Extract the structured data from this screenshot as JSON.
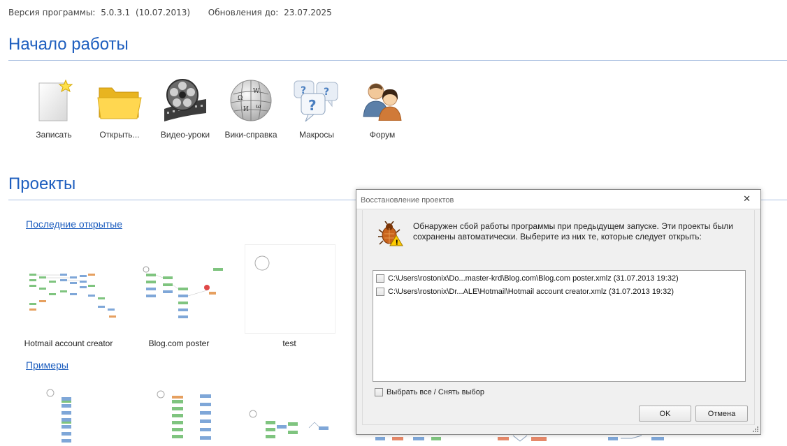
{
  "version_bar": {
    "version_label": "Версия программы:",
    "version_value": "5.0.3.1",
    "version_date": "(10.07.2013)",
    "updates_label": "Обновления до:",
    "updates_value": "23.07.2025"
  },
  "start": {
    "title": "Начало работы",
    "actions": [
      {
        "label": "Записать",
        "icon": "new-document-icon"
      },
      {
        "label": "Открыть...",
        "icon": "folder-icon"
      },
      {
        "label": "Видео-уроки",
        "icon": "film-reel-icon"
      },
      {
        "label": "Вики-справка",
        "icon": "wikipedia-globe-icon"
      },
      {
        "label": "Макросы",
        "icon": "question-bubbles-icon"
      },
      {
        "label": "Форум",
        "icon": "users-icon"
      }
    ]
  },
  "projects": {
    "title": "Проекты",
    "recent_link": "Последние открытые",
    "recent": [
      {
        "label": "Hotmail account creator"
      },
      {
        "label": "Blog.com poster"
      },
      {
        "label": "test"
      }
    ],
    "examples_link": "Примеры"
  },
  "dialog": {
    "title": "Восстановление проектов",
    "close_glyph": "✕",
    "message": "Обнаружен сбой работы программы при предыдущем запуске. Эти проекты были сохранены автоматически. Выберите из них те, которые следует открыть:",
    "files": [
      {
        "label": "C:\\Users\\rostonix\\Do...master-krd\\Blog.com\\Blog.com poster.xmlz (31.07.2013 19:32)",
        "checked": false
      },
      {
        "label": "C:\\Users\\rostonix\\Dr...ALE\\Hotmail\\Hotmail account creator.xmlz (31.07.2013 19:32)",
        "checked": false
      }
    ],
    "select_all": "Выбрать все / Снять выбор",
    "ok": "OK",
    "cancel": "Отмена"
  },
  "colors": {
    "accent": "#1f5fbf",
    "divider": "#a9c0e0",
    "dialog_bg": "#f0f0f0"
  }
}
